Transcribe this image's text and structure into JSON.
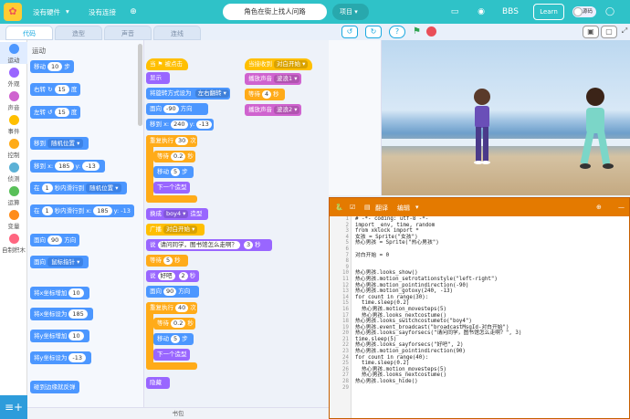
{
  "topbar": {
    "menu_hardware": "没有硬件",
    "menu_connect": "没有连接",
    "project_title": "角色在街上找人问路",
    "project_menu": "项目",
    "bbs": "BBS",
    "learn": "Learn",
    "mode": "源码",
    "icons": [
      "file-icon",
      "globe-icon",
      "bell-icon",
      "camera-icon",
      "save-icon",
      "user-icon"
    ]
  },
  "tabs": [
    "代码",
    "造型",
    "声音",
    "连线"
  ],
  "categories": [
    {
      "label": "运动",
      "color": "#4c97ff"
    },
    {
      "label": "外观",
      "color": "#9966ff"
    },
    {
      "label": "声音",
      "color": "#cf63cf"
    },
    {
      "label": "事件",
      "color": "#ffbf00"
    },
    {
      "label": "控制",
      "color": "#ffab19"
    },
    {
      "label": "侦测",
      "color": "#5cb1d6"
    },
    {
      "label": "运算",
      "color": "#59c059"
    },
    {
      "label": "变量",
      "color": "#ff8c1a"
    },
    {
      "label": "自制积木",
      "color": "#ff6680"
    }
  ],
  "palette": {
    "title": "运动",
    "blocks": [
      {
        "pre": "移动",
        "box": "10",
        "post": "步"
      },
      {
        "pre": "右转",
        "icon": "↻",
        "box": "15",
        "post": "度"
      },
      {
        "pre": "左转",
        "icon": "↺",
        "box": "15",
        "post": "度"
      },
      {
        "pre": "移到",
        "drop": "随机位置"
      },
      {
        "pre": "移到 x:",
        "box": "185",
        "mid": "y:",
        "box2": "-13"
      },
      {
        "pre": "在",
        "box": "1",
        "mid": "秒内滑行到",
        "drop": "随机位置"
      },
      {
        "pre": "在",
        "box": "1",
        "mid": "秒内滑行到 x:",
        "box2": "185",
        "post": "y: -13"
      },
      {
        "pre": "面向",
        "box": "90",
        "post": "方向"
      },
      {
        "pre": "面向",
        "drop": "鼠标指针"
      },
      {
        "pre": "将x坐标增加",
        "box": "10"
      },
      {
        "pre": "将x坐标设为",
        "box": "185"
      },
      {
        "pre": "将y坐标增加",
        "box": "10"
      },
      {
        "pre": "将y坐标设为",
        "box": "-13"
      },
      {
        "pre": "碰到边缘就反弹"
      }
    ]
  },
  "script1": [
    "当 ⚑ 被点击",
    "显示",
    "将旋转方式设为|左右翻转",
    "面向|-90|方向",
    "移到 x:|240|y:|-13",
    "重复执行|30|次",
    "等待|0.2|秒",
    "移动|5|步",
    "下一个造型",
    "换成|boy4|造型",
    "广播|对白开始",
    "说|请问同学，图书馆怎么走啊？|3|秒",
    "等待|5|秒",
    "说|好吧|2|秒",
    "面向|90|方向",
    "重复执行|40|次",
    "等待|0.2|秒",
    "移动|5|步",
    "下一个造型",
    "隐藏"
  ],
  "script2": [
    "当接收到|对白开始",
    "播放声音|波浪1",
    "等待|4|秒",
    "播放声音|波浪2"
  ],
  "status": "书包",
  "python": {
    "title": "翻译",
    "menu": "编辑",
    "lines": [
      "# -*- coding: utf-8 -*-",
      "import _env, time, random",
      "from xklock import *",
      "女孩 = Sprite(\"女孩\")",
      "热心男孩 = Sprite(\"热心男孩\")",
      "",
      "对白开始 = 0",
      "",
      "",
      "热心男孩.looks_show()",
      "热心男孩.motion_setrotationstyle(\"left-right\")",
      "热心男孩.motion_pointindirection(-90)",
      "热心男孩.motion_gotoxy(240, -13)",
      "for count in range(30):",
      "  time.sleep(0.2)",
      "  热心男孩.motion_movesteps(5)",
      "  热心男孩.looks_nextcostume()",
      "热心男孩.looks_switchcostumeto(\"boy4\")",
      "热心男孩.event_broadcast(\"broadcastMsgId-对白开始\")",
      "热心男孩.looks_sayforsecs(\"请问同学，图书馆怎么走啊？\", 3)",
      "time.sleep(5)",
      "热心男孩.looks_sayforsecs(\"好吧\", 2)",
      "热心男孩.motion_pointindirection(90)",
      "for count in range(40):",
      "  time.sleep(0.2)",
      "  热心男孩.motion_movesteps(5)",
      "  热心男孩.looks_nextcostume()",
      "热心男孩.looks_hide()",
      ""
    ]
  }
}
